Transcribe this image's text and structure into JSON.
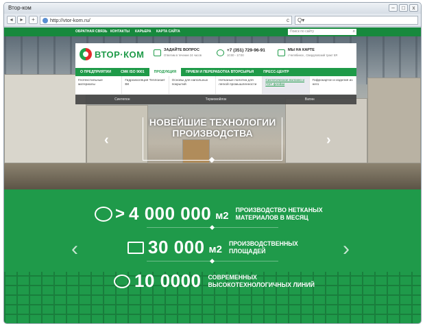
{
  "window": {
    "title": "Втор-ком"
  },
  "browser": {
    "url": "http://vtor-kom.ru/",
    "search_placeholder": "Q▾",
    "back_icon": "◂",
    "forward_icon": "▸",
    "add_icon": "+",
    "refresh_icon": "c"
  },
  "window_buttons": {
    "min": "–",
    "max": "□",
    "close": "x"
  },
  "topbar": {
    "links": [
      "ОБРАТНАЯ СВЯЗЬ",
      "КОНТАКТЫ",
      "КАРЬЕРА",
      "КАРТА САЙТА"
    ],
    "search_placeholder": "Поиск по сайту"
  },
  "header": {
    "logo_text": "ВТОР·КОМ",
    "ask_title": "ЗАДАЙТЕ ВОПРОС",
    "ask_sub": "Ответим в течение 24 часов",
    "phone": "+7 (351) 729-96-91",
    "phone_hours": "10:00 - 17:00",
    "map_title": "МЫ НА КАРТЕ",
    "map_sub": "г.Челябинск , Свердловский тракт 5Я"
  },
  "nav": {
    "items": [
      "О ПРЕДПРИЯТИИ",
      "СМК ISO 9001",
      "ПРОДУКЦИЯ",
      "ПРИЕМ И ПЕРЕРАБОТКА ВТОРСЫРЬЯ",
      "ПРЕСС-ЦЕНТР"
    ],
    "active": "ПРОДУКЦИЯ"
  },
  "submenu": [
    "Геотекстильные материалы",
    "Гидроизоляция Теплоизит ВК",
    "Основы для напольных покрытий",
    "Нетканые полотна для легкой промышленности",
    "Синтетическое волокно и ПЭТ флейки",
    "Гофрокартон и изделия из него"
  ],
  "subsub": [
    "Синтепон",
    "Термовойлок",
    "Ватин"
  ],
  "hero": {
    "title_line1": "НОВЕЙШИЕ ТЕХНОЛОГИИ",
    "title_line2": "ПРОИЗВОДСТВА"
  },
  "stats": [
    {
      "prefix": ">",
      "number": "4 000 000",
      "unit": "м2",
      "desc": "ПРОИЗВОДСТВО НЕТКАНЫХ\nМАТЕРИАЛОВ В МЕСЯЦ"
    },
    {
      "prefix": "",
      "number": "30 000",
      "unit": "м2",
      "desc": "ПРОИЗВОДСТВЕННЫХ\nПЛОЩАДЕЙ"
    },
    {
      "prefix": "",
      "number": "10 0000",
      "unit": "",
      "desc": "СОВРЕМЕННЫХ\nВЫСОКОТЕХНОЛОГИЧНЫХ ЛИНИЙ"
    }
  ],
  "arrows": {
    "left": "‹",
    "right": "›"
  },
  "colors": {
    "brand_green": "#1e9a48",
    "logo_red": "#e32b2b"
  }
}
